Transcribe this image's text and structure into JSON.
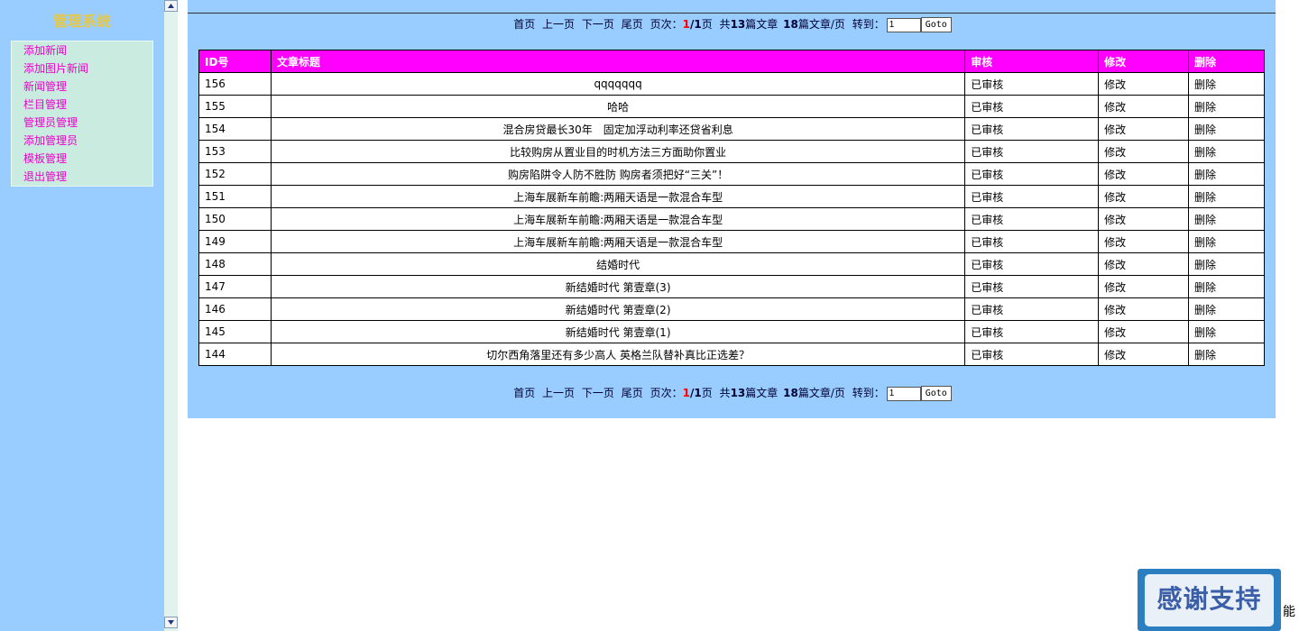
{
  "sidebar": {
    "title": "管理系统",
    "items": [
      {
        "label": "添加新闻"
      },
      {
        "label": "添加图片新闻"
      },
      {
        "label": "新闻管理"
      },
      {
        "label": "栏目管理"
      },
      {
        "label": "管理员管理"
      },
      {
        "label": "添加管理员"
      },
      {
        "label": "模板管理"
      },
      {
        "label": "退出管理"
      }
    ]
  },
  "pager": {
    "first": "首页",
    "prev": "上一页",
    "next": "下一页",
    "last": "尾页",
    "page_label": "页次：",
    "current_page": "1",
    "separator": "/",
    "total_pages": "1",
    "page_suffix": "页",
    "total_prefix": "共",
    "total_articles": "13",
    "total_suffix": "篇文章",
    "per_page": "18",
    "per_page_suffix": "篇文章/页",
    "goto_label": "转到：",
    "goto_value": "1",
    "goto_button": "Goto"
  },
  "table": {
    "headers": {
      "id": "ID号",
      "title": "文章标题",
      "audit": "审核",
      "edit": "修改",
      "delete": "删除"
    },
    "rows": [
      {
        "id": "156",
        "title": "qqqqqqq",
        "audit": "已审核",
        "edit": "修改",
        "delete": "删除"
      },
      {
        "id": "155",
        "title": "哈哈",
        "audit": "已审核",
        "edit": "修改",
        "delete": "删除"
      },
      {
        "id": "154",
        "title": "混合房贷最长30年　固定加浮动利率还贷省利息",
        "audit": "已审核",
        "edit": "修改",
        "delete": "删除"
      },
      {
        "id": "153",
        "title": "比较购房从置业目的时机方法三方面助你置业",
        "audit": "已审核",
        "edit": "修改",
        "delete": "删除"
      },
      {
        "id": "152",
        "title": "购房陷阱令人防不胜防 购房者须把好“三关”！",
        "audit": "已审核",
        "edit": "修改",
        "delete": "删除"
      },
      {
        "id": "151",
        "title": "上海车展新车前瞻:两厢天语是一款混合车型",
        "audit": "已审核",
        "edit": "修改",
        "delete": "删除"
      },
      {
        "id": "150",
        "title": "上海车展新车前瞻:两厢天语是一款混合车型",
        "audit": "已审核",
        "edit": "修改",
        "delete": "删除"
      },
      {
        "id": "149",
        "title": "上海车展新车前瞻:两厢天语是一款混合车型",
        "audit": "已审核",
        "edit": "修改",
        "delete": "删除"
      },
      {
        "id": "148",
        "title": "结婚时代",
        "audit": "已审核",
        "edit": "修改",
        "delete": "删除"
      },
      {
        "id": "147",
        "title": "新结婚时代 第壹章(3)",
        "audit": "已审核",
        "edit": "修改",
        "delete": "删除"
      },
      {
        "id": "146",
        "title": "新结婚时代 第壹章(2)",
        "audit": "已审核",
        "edit": "修改",
        "delete": "删除"
      },
      {
        "id": "145",
        "title": "新结婚时代 第壹章(1)",
        "audit": "已审核",
        "edit": "修改",
        "delete": "删除"
      },
      {
        "id": "144",
        "title": "切尔西角落里还有多少高人 英格兰队替补真比正选差？",
        "audit": "已审核",
        "edit": "修改",
        "delete": "删除"
      }
    ]
  },
  "support_badge": {
    "label": "感谢支持"
  },
  "edge_glyph": "能",
  "colors": {
    "panel_bg": "#99ccff",
    "menu_bg": "#c9ebe0",
    "menu_text": "#ee00cc",
    "header_bg": "#ff00ff",
    "title_text": "#e8c840",
    "current_page": "#ff0000"
  }
}
